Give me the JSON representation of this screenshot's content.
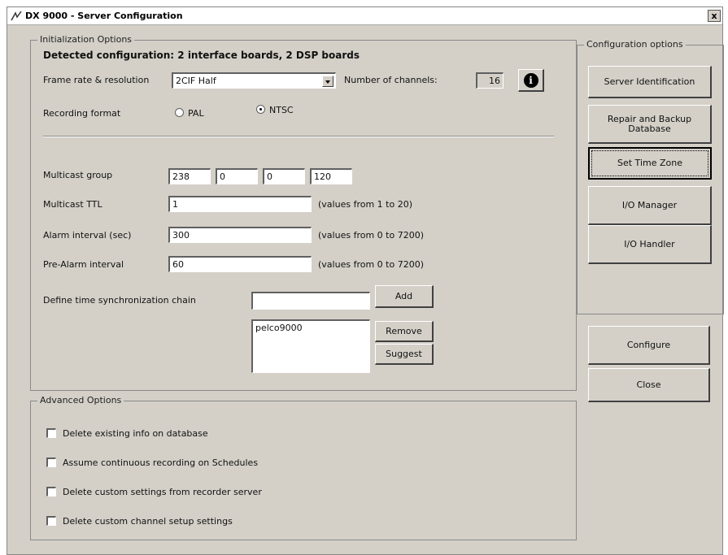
{
  "window": {
    "title": "DX 9000 - Server Configuration",
    "close_label": "x"
  },
  "init": {
    "group_label": "Initialization Options",
    "detected": "Detected configuration: 2 interface boards, 2 DSP boards",
    "frame_rate_label": "Frame rate & resolution",
    "frame_rate_value": "2CIF Half",
    "channels_label": "Number of channels:",
    "channels_value": "16",
    "recording_format_label": "Recording format",
    "format_pal": "PAL",
    "format_ntsc": "NTSC",
    "multicast_group_label": "Multicast group",
    "multicast_group": [
      "238",
      "0",
      "0",
      "120"
    ],
    "multicast_ttl_label": "Multicast TTL",
    "multicast_ttl_value": "1",
    "multicast_ttl_hint": "(values from 1 to 20)",
    "alarm_interval_label": "Alarm interval (sec)",
    "alarm_interval_value": "300",
    "alarm_interval_hint": "(values from 0 to 7200)",
    "prealarm_label": "Pre-Alarm interval",
    "prealarm_value": "60",
    "prealarm_hint": "(values from 0 to 7200)",
    "sync_chain_label": "Define time synchronization chain",
    "sync_chain_input": "",
    "sync_list": [
      "pelco9000"
    ],
    "add_label": "Add",
    "remove_label": "Remove",
    "suggest_label": "Suggest"
  },
  "advanced": {
    "group_label": "Advanced Options",
    "options": [
      "Delete existing info on database",
      "Assume continuous recording on Schedules",
      "Delete custom settings from recorder server",
      "Delete custom channel setup settings"
    ]
  },
  "config_options": {
    "group_label": "Configuration options",
    "buttons": [
      "Server Identification",
      "Repair and Backup Database",
      "Set Time Zone",
      "I/O Manager",
      "I/O Handler"
    ]
  },
  "actions": {
    "configure_label": "Configure",
    "close_label": "Close"
  }
}
